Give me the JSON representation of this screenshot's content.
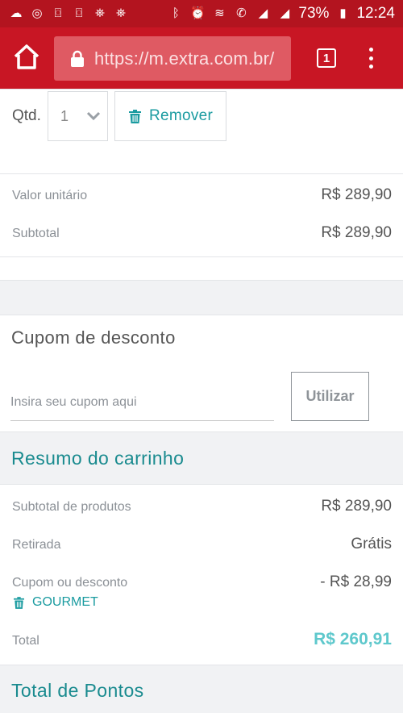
{
  "statusbar": {
    "battery": "73%",
    "time": "12:24"
  },
  "browser": {
    "url": "https://m.extra.com.br/",
    "tab_count": "1"
  },
  "item": {
    "qty_label": "Qtd.",
    "qty_value": "1",
    "remove_label": "Remover",
    "unit_value_label": "Valor unitário",
    "unit_value": "R$ 289,90",
    "subtotal_label": "Subtotal",
    "subtotal": "R$ 289,90"
  },
  "coupon": {
    "title": "Cupom de desconto",
    "placeholder": "Insira seu cupom aqui",
    "button_label": "Utilizar"
  },
  "summary": {
    "title": "Resumo do carrinho",
    "products_subtotal_label": "Subtotal de produtos",
    "products_subtotal": "R$ 289,90",
    "pickup_label": "Retirada",
    "pickup_value": "Grátis",
    "discount_label": "Cupom ou desconto",
    "discount_value": "- R$ 28,99",
    "coupon_code": "GOURMET",
    "total_label": "Total",
    "total_value": "R$ 260,91"
  },
  "points": {
    "title": "Total de Pontos"
  },
  "colors": {
    "brand_red": "#c81624",
    "teal": "#1a8b8f",
    "total_teal": "#5ec8cc"
  }
}
